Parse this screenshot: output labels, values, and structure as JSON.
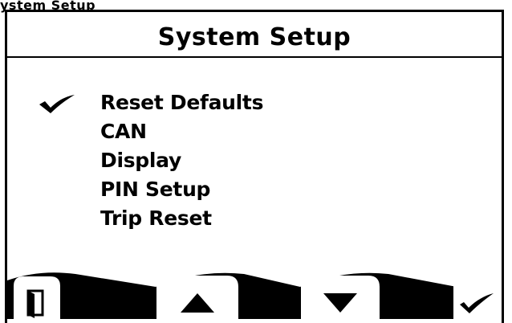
{
  "caption": "ystem Setup",
  "screen": {
    "title": "System Setup"
  },
  "menu": {
    "selected_index": 0,
    "items": [
      {
        "label": "Reset Defaults",
        "selected": true
      },
      {
        "label": "CAN",
        "selected": false
      },
      {
        "label": "Display",
        "selected": false
      },
      {
        "label": "PIN Setup",
        "selected": false
      },
      {
        "label": "Trip Reset",
        "selected": false
      }
    ]
  },
  "softkeys": [
    {
      "name": "exit",
      "icon": "door-icon"
    },
    {
      "name": "up",
      "icon": "arrow-up-icon"
    },
    {
      "name": "down",
      "icon": "arrow-down-icon"
    },
    {
      "name": "select",
      "icon": "check-icon"
    }
  ],
  "colors": {
    "foreground": "#000000",
    "background": "#ffffff"
  }
}
